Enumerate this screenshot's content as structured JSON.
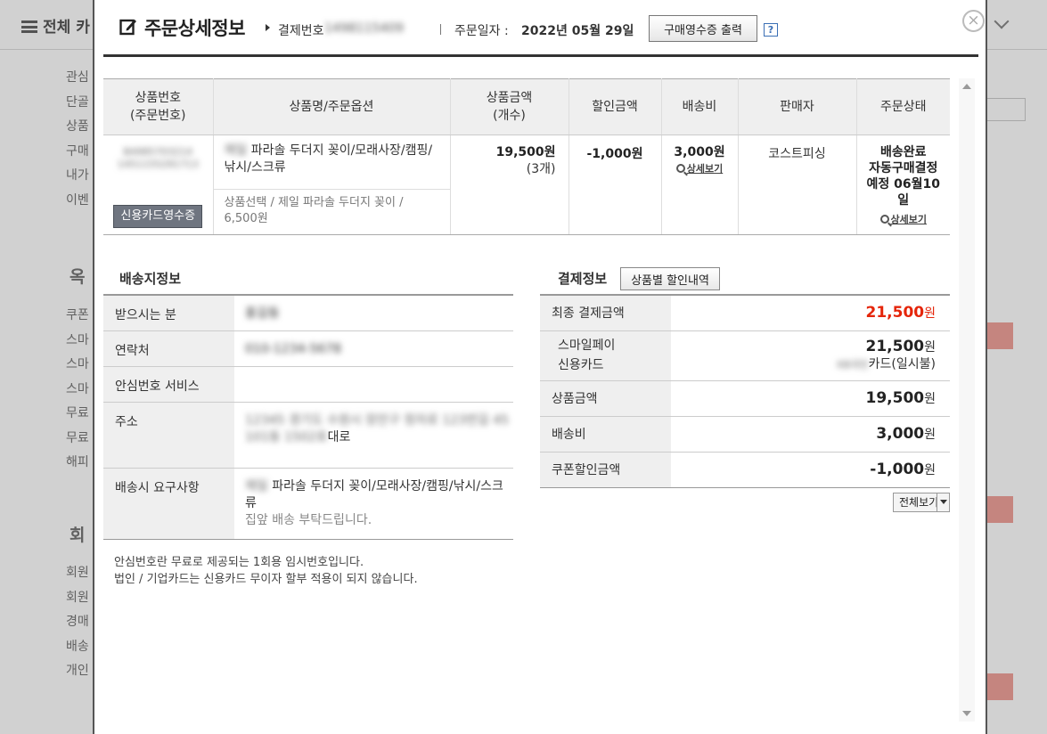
{
  "background": {
    "menu_label": "전체 카",
    "left_items": [
      "관심",
      "단골",
      "상품",
      "구매",
      "내가",
      "이벤"
    ],
    "section_auction": "옥",
    "left_items_2": [
      "쿠폰",
      "스마",
      "스마",
      "스마",
      "무료",
      "무료",
      "해피"
    ],
    "section_member": "회",
    "left_items_3": [
      "회원",
      "회원",
      "경매",
      "배송",
      "개인"
    ]
  },
  "modal": {
    "title": "주문상세정보",
    "payment_no_label": "결제번호",
    "payment_no": "1498115409",
    "order_date_label": "주문일자 :",
    "order_date": "2022년 05월 29일",
    "print_receipt": "구매영수증 출력",
    "help": "?",
    "close": "×"
  },
  "order_table": {
    "headers": [
      "상품번호\n(주문번호)",
      "상품명/주문옵션",
      "상품금액\n(개수)",
      "할인금액",
      "배송비",
      "판매자",
      "주문상태"
    ],
    "row": {
      "product_no": "B4985703214",
      "order_no": "1451155291713",
      "card_receipt": "신용카드영수증",
      "product_name": "파라솔 두더지 꽂이/모래사장/캠핑/낚시/스크류",
      "product_name_prefix": "제일",
      "option": "상품선택 / 제일 파라솔 두더지 꽂이 / 6,500원",
      "price": "19,500원",
      "qty": "(3개)",
      "discount": "-1,000원",
      "shipping": "3,000원",
      "shipping_detail": "상세보기",
      "seller": "코스트피싱",
      "status_1": "배송완료",
      "status_2": "자동구매결정",
      "status_3": "예정 06월10",
      "status_4": "일",
      "status_detail": "상세보기"
    }
  },
  "delivery": {
    "title": "배송지정보",
    "rows": [
      {
        "label": "받으시는 분",
        "value": "홍길동"
      },
      {
        "label": "연락처",
        "value": "010-1234-5678"
      },
      {
        "label": "안심번호 서비스",
        "value": ""
      },
      {
        "label": "주소",
        "value_blur": "12345 경기도 수원시 장안구 정자로 123번길 45 101동 1502호",
        "value_visible": "대로"
      },
      {
        "label": "배송시 요구사항",
        "value_prefix": "제일",
        "value": "파라솔 두더지 꽂이/모래사장/캠핑/낚시/스크류",
        "value_2": "집앞 배송 부탁드립니다."
      }
    ],
    "note_1": "안심번호란 무료로 제공되는 1회용 임시번호입니다.",
    "note_2": "법인 / 기업카드는 신용카드 무이자 할부 적용이 되지 않습니다."
  },
  "payment": {
    "title": "결제정보",
    "discount_btn": "상품별 할인내역",
    "final_label": "최종 결제금액",
    "final_amount": "21,500",
    "won": "원",
    "method_1": "스마일페이",
    "method_2": "신용카드",
    "method_amount": "21,500",
    "card_name_blur": "KB국민",
    "card_suffix": "카드(일시불)",
    "rows": [
      {
        "label": "상품금액",
        "amount": "19,500"
      },
      {
        "label": "배송비",
        "amount": "3,000"
      },
      {
        "label": "쿠폰할인금액",
        "amount": "-1,000"
      }
    ],
    "view_all": "전체보기"
  },
  "colors": {
    "accent_red": "#e5250a",
    "header_bg": "#efefef"
  }
}
